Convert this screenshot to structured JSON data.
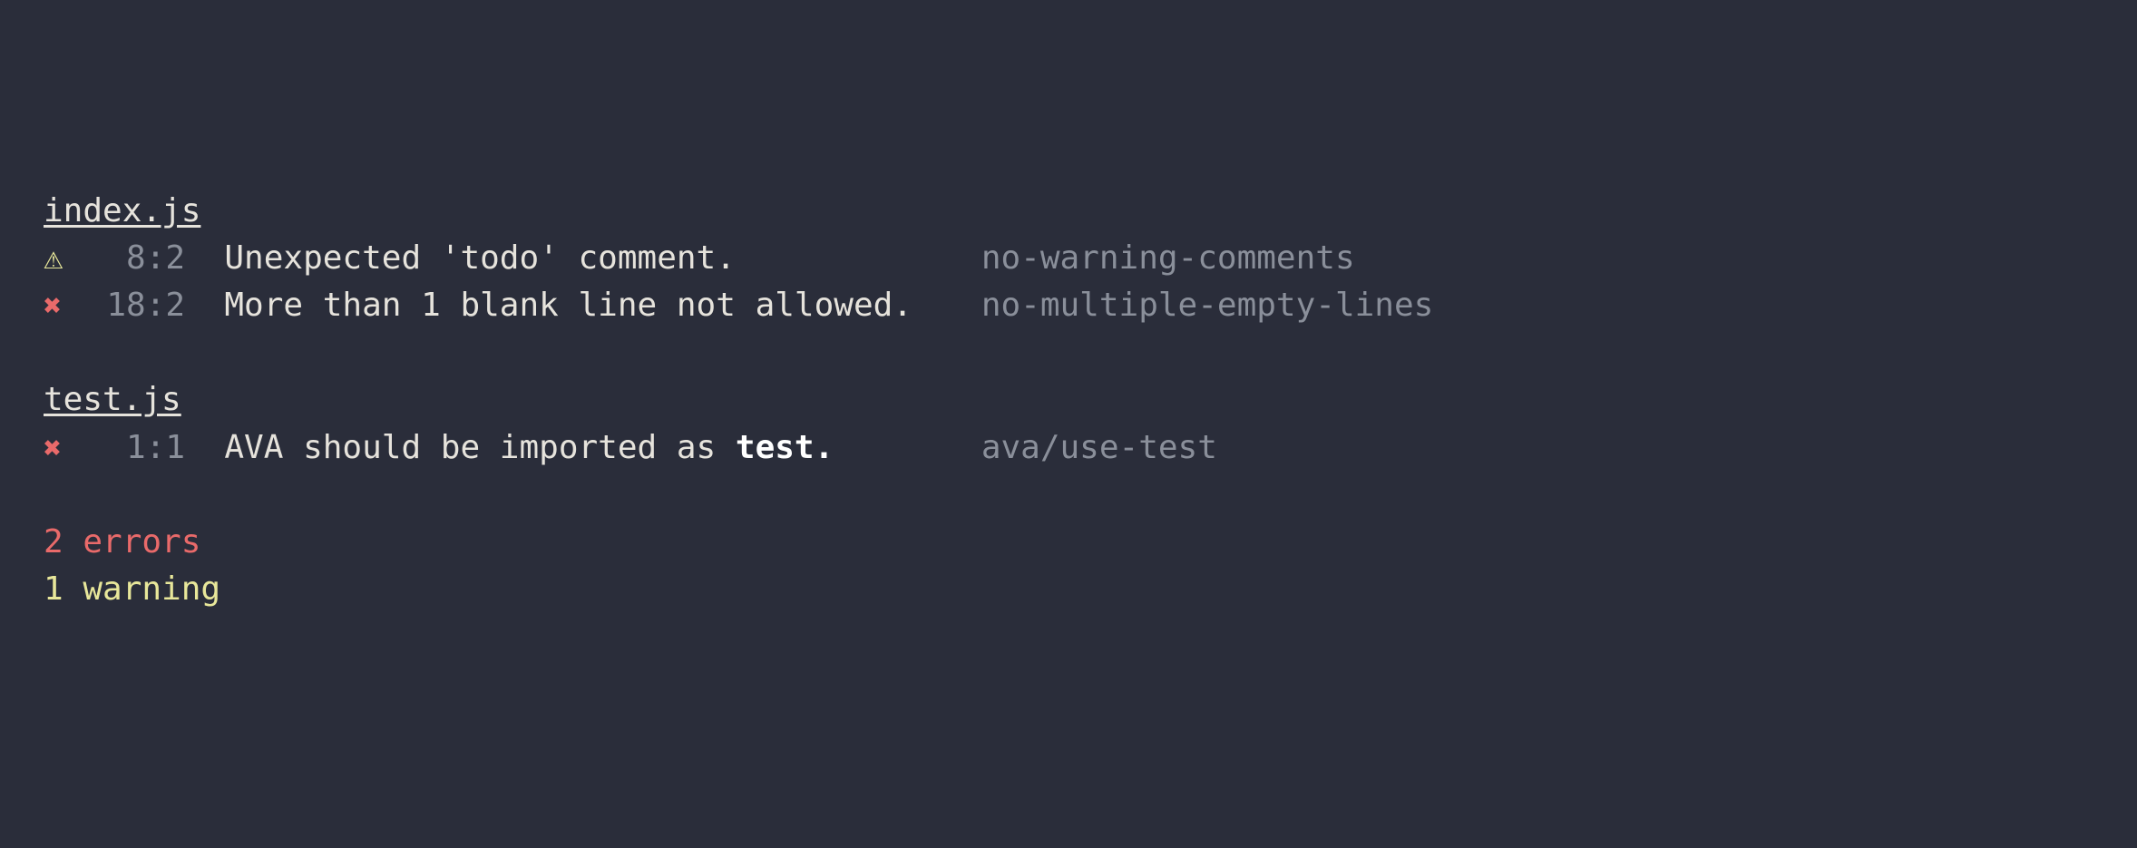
{
  "colors": {
    "bg": "#2a2d3a",
    "text": "#e6e3dc",
    "dim": "#8a8f9a",
    "error": "#e96a6a",
    "warning": "#e8e79a"
  },
  "files": [
    {
      "name": "index.js",
      "items": [
        {
          "severity": "warning",
          "line": 8,
          "col": 2,
          "message": "Unexpected 'todo' comment.",
          "rule": "no-warning-comments"
        },
        {
          "severity": "error",
          "line": 18,
          "col": 2,
          "message": "More than 1 blank line not allowed.",
          "rule": "no-multiple-empty-lines"
        }
      ]
    },
    {
      "name": "test.js",
      "items": [
        {
          "severity": "error",
          "line": 1,
          "col": 1,
          "message_html": "AVA should be imported as <b>test.</b>",
          "rule": "ava/use-test"
        }
      ]
    }
  ],
  "summary": {
    "errors": "2 errors",
    "warnings": "1 warning"
  },
  "icons": {
    "warning": "⚠",
    "error": "✖"
  }
}
